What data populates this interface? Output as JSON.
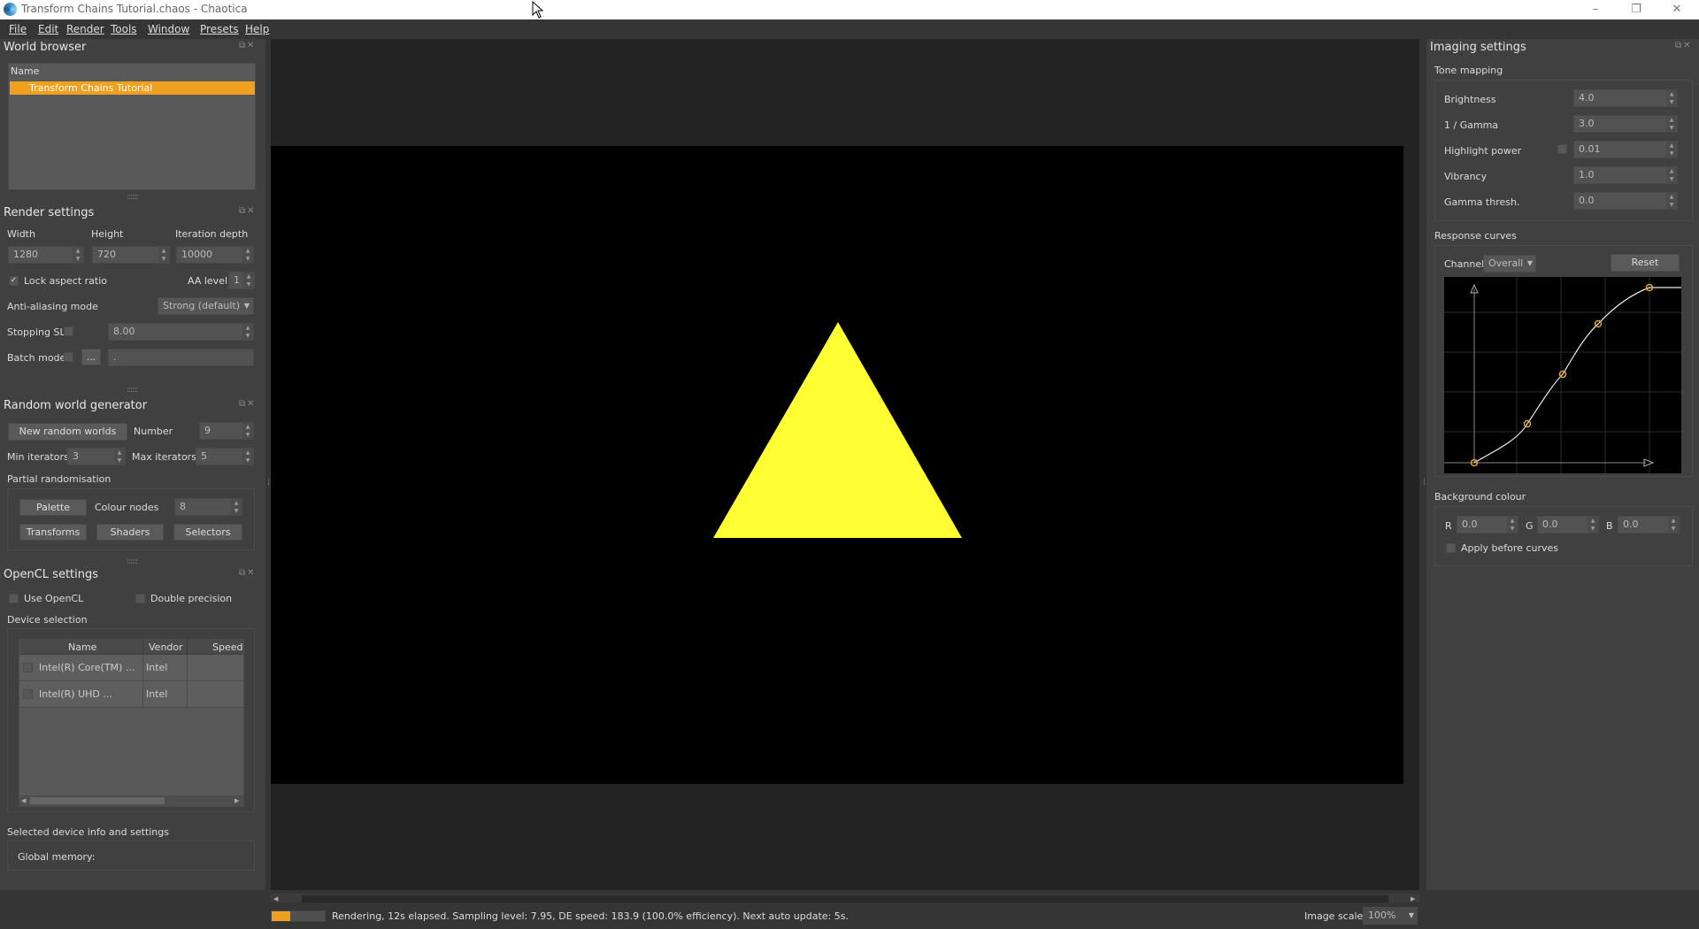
{
  "titlebar": {
    "title": "Transform Chains Tutorial.chaos - Chaotica",
    "controls": [
      "–",
      "❐",
      "✕"
    ]
  },
  "menu": [
    "File",
    "Edit",
    "Render",
    "Tools",
    "Window",
    "Presets",
    "Help"
  ],
  "world_browser": {
    "title": "World browser",
    "column": "Name",
    "items": [
      "Transform Chains Tutorial"
    ]
  },
  "render_settings": {
    "title": "Render settings",
    "width_label": "Width",
    "height_label": "Height",
    "depth_label": "Iteration depth",
    "width": "1280",
    "height": "720",
    "depth": "10000",
    "lock_label": "Lock aspect ratio",
    "lock_checked": "✓",
    "aa_level_label": "AA level",
    "aa_level": "1",
    "aa_mode_label": "Anti-aliasing mode",
    "aa_mode": "Strong (default)",
    "stopping_label": "Stopping SL",
    "stopping_value": "8.00",
    "batch_label": "Batch mode",
    "batch_button": "...",
    "batch_value": "."
  },
  "random_world": {
    "title": "Random world generator",
    "new_button": "New random worlds",
    "number_label": "Number",
    "number": "9",
    "min_label": "Min iterators",
    "min": "3",
    "max_label": "Max iterators",
    "max": "5",
    "partial_label": "Partial randomisation",
    "palette_button": "Palette",
    "colour_nodes_label": "Colour nodes",
    "colour_nodes": "8",
    "transforms_button": "Transforms",
    "shaders_button": "Shaders",
    "selectors_button": "Selectors"
  },
  "opencl": {
    "title": "OpenCL settings",
    "use_label": "Use OpenCL",
    "double_label": "Double precision",
    "device_label": "Device selection",
    "columns": [
      "Name",
      "Vendor",
      "Speed"
    ],
    "devices": [
      {
        "name": "Intel(R) Core(TM) ...",
        "vendor": "Intel",
        "speed": ""
      },
      {
        "name": "Intel(R) UHD ...",
        "vendor": "Intel",
        "speed": ""
      }
    ],
    "info_label": "Selected device info and settings",
    "memory_label": "Global memory:"
  },
  "imaging": {
    "title": "Imaging settings",
    "tone_label": "Tone mapping",
    "params": [
      {
        "label": "Brightness",
        "value": "4.0"
      },
      {
        "label": "1 / Gamma",
        "value": "3.0"
      },
      {
        "label": "Highlight power",
        "value": "0.01"
      },
      {
        "label": "Vibrancy",
        "value": "1.0"
      },
      {
        "label": "Gamma thresh.",
        "value": "0.0"
      }
    ],
    "curves_label": "Response curves",
    "channel_label": "Channel:",
    "channel": "Overall",
    "reset_button": "Reset",
    "bg_label": "Background colour",
    "r_label": "R",
    "r": "0.0",
    "g_label": "G",
    "g": "0.0",
    "b_label": "B",
    "b": "0.0",
    "apply_label": "Apply before curves"
  },
  "status": {
    "text": "Rendering, 12s elapsed. Sampling level: 7.95, DE speed: 183.9 (100.0% efficiency). Next auto update: 5s.",
    "scale_label": "Image scale:",
    "scale": "100%",
    "progress": 0.35
  },
  "colors": {
    "accent": "#f0a020",
    "triangle": "#ffff33",
    "curve_point": "#e8a030"
  },
  "icons": {
    "panel": "float-close-icons",
    "spinner": "up-down-arrows"
  }
}
